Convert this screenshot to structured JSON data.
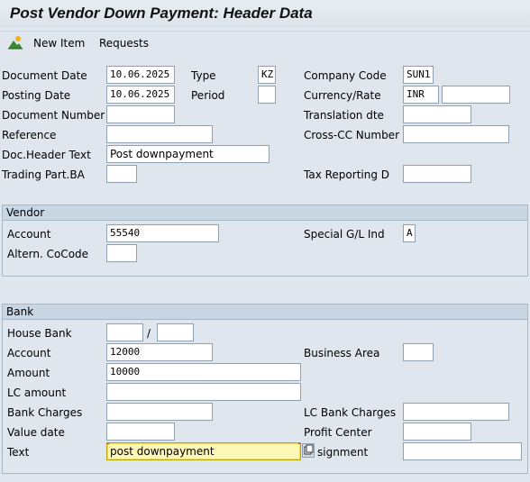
{
  "title": "Post Vendor Down Payment: Header Data",
  "toolbar": {
    "new_item": "New Item",
    "requests": "Requests",
    "icon": "mountain-icon"
  },
  "header": {
    "document_date": {
      "label": "Document Date",
      "value": "10.06.2025"
    },
    "type": {
      "label": "Type",
      "value": "KZ"
    },
    "company_code": {
      "label": "Company Code",
      "value": "SUN1"
    },
    "posting_date": {
      "label": "Posting Date",
      "value": "10.06.2025"
    },
    "period": {
      "label": "Period",
      "value": ""
    },
    "currency_rate": {
      "label": "Currency/Rate",
      "value": "INR",
      "rate": ""
    },
    "document_number": {
      "label": "Document Number",
      "value": ""
    },
    "translation_date": {
      "label": "Translation dte",
      "value": ""
    },
    "reference": {
      "label": "Reference",
      "value": ""
    },
    "cross_cc_number": {
      "label": "Cross-CC Number",
      "value": ""
    },
    "doc_header_text": {
      "label": "Doc.Header Text",
      "value": "Post downpayment"
    },
    "trading_part_ba": {
      "label": "Trading Part.BA",
      "value": ""
    },
    "tax_reporting": {
      "label": "Tax Reporting D",
      "value": ""
    }
  },
  "vendor": {
    "title": "Vendor",
    "account": {
      "label": "Account",
      "value": "55540"
    },
    "special_gl": {
      "label": "Special G/L Ind",
      "value": "A"
    },
    "altern_cocode": {
      "label": "Altern. CoCode",
      "value": ""
    }
  },
  "bank": {
    "title": "Bank",
    "house_bank": {
      "label": "House Bank",
      "value": "",
      "separator": "/",
      "value2": ""
    },
    "account": {
      "label": "Account",
      "value": "12000"
    },
    "business_area": {
      "label": "Business Area",
      "value": ""
    },
    "amount": {
      "label": "Amount",
      "value": "10000"
    },
    "lc_amount": {
      "label": "LC amount",
      "value": ""
    },
    "bank_charges": {
      "label": "Bank Charges",
      "value": ""
    },
    "lc_bank_charges": {
      "label": "LC Bank Charges",
      "value": ""
    },
    "value_date": {
      "label": "Value date",
      "value": ""
    },
    "profit_center": {
      "label": "Profit Center",
      "value": ""
    },
    "text": {
      "label": "Text",
      "value": "post downpayment"
    },
    "assignment": {
      "label": "signment",
      "value": ""
    }
  }
}
